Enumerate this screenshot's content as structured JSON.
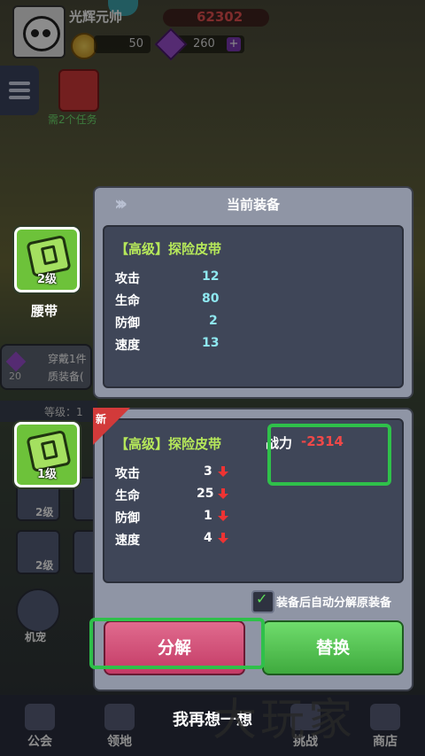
{
  "player": {
    "name": "光辉元帅",
    "power": "62302",
    "coins": "50",
    "gems": "260",
    "gem_plus": "+"
  },
  "top": {
    "task_hint": "需2个任务"
  },
  "background": {
    "wear_hint_line1": "穿戴1件",
    "wear_hint_line2": "质装备(",
    "wear_count": "20",
    "level_label": "等级：1",
    "mini_level_1": "2级",
    "mini_level_2": "2级",
    "pet_label": "机宠"
  },
  "slot": {
    "name": "腰带",
    "level": "2级"
  },
  "new_item": {
    "level": "1级",
    "tag": "新"
  },
  "current_panel": {
    "title": "当前装备",
    "item_name": "【高级】探险皮带",
    "stats": [
      {
        "label": "攻击",
        "value": "12"
      },
      {
        "label": "生命",
        "value": "80"
      },
      {
        "label": "防御",
        "value": "2"
      },
      {
        "label": "速度",
        "value": "13"
      }
    ]
  },
  "new_panel": {
    "item_name": "【高级】探险皮带",
    "power_label": "战力",
    "power_diff": "-2314",
    "stats": [
      {
        "label": "攻击",
        "value": "3",
        "trend": "down"
      },
      {
        "label": "生命",
        "value": "25",
        "trend": "down"
      },
      {
        "label": "防御",
        "value": "1",
        "trend": "down"
      },
      {
        "label": "速度",
        "value": "4",
        "trend": "down"
      }
    ],
    "auto_split_label": "装备后自动分解原装备",
    "auto_split_checked": true,
    "split_button": "分解",
    "swap_button": "替换"
  },
  "bottom": {
    "rethink": "我再想一想",
    "nav": [
      {
        "label": "公会"
      },
      {
        "label": "领地"
      },
      {
        "label": "挑战"
      },
      {
        "label": "商店"
      }
    ]
  },
  "watermark": "大玩家",
  "colors": {
    "highlight": "#2fc04a",
    "split": "#c43b66",
    "swap": "#3faa3e",
    "stat_value": "#8fe8f0",
    "item_name": "#b6e85a"
  }
}
